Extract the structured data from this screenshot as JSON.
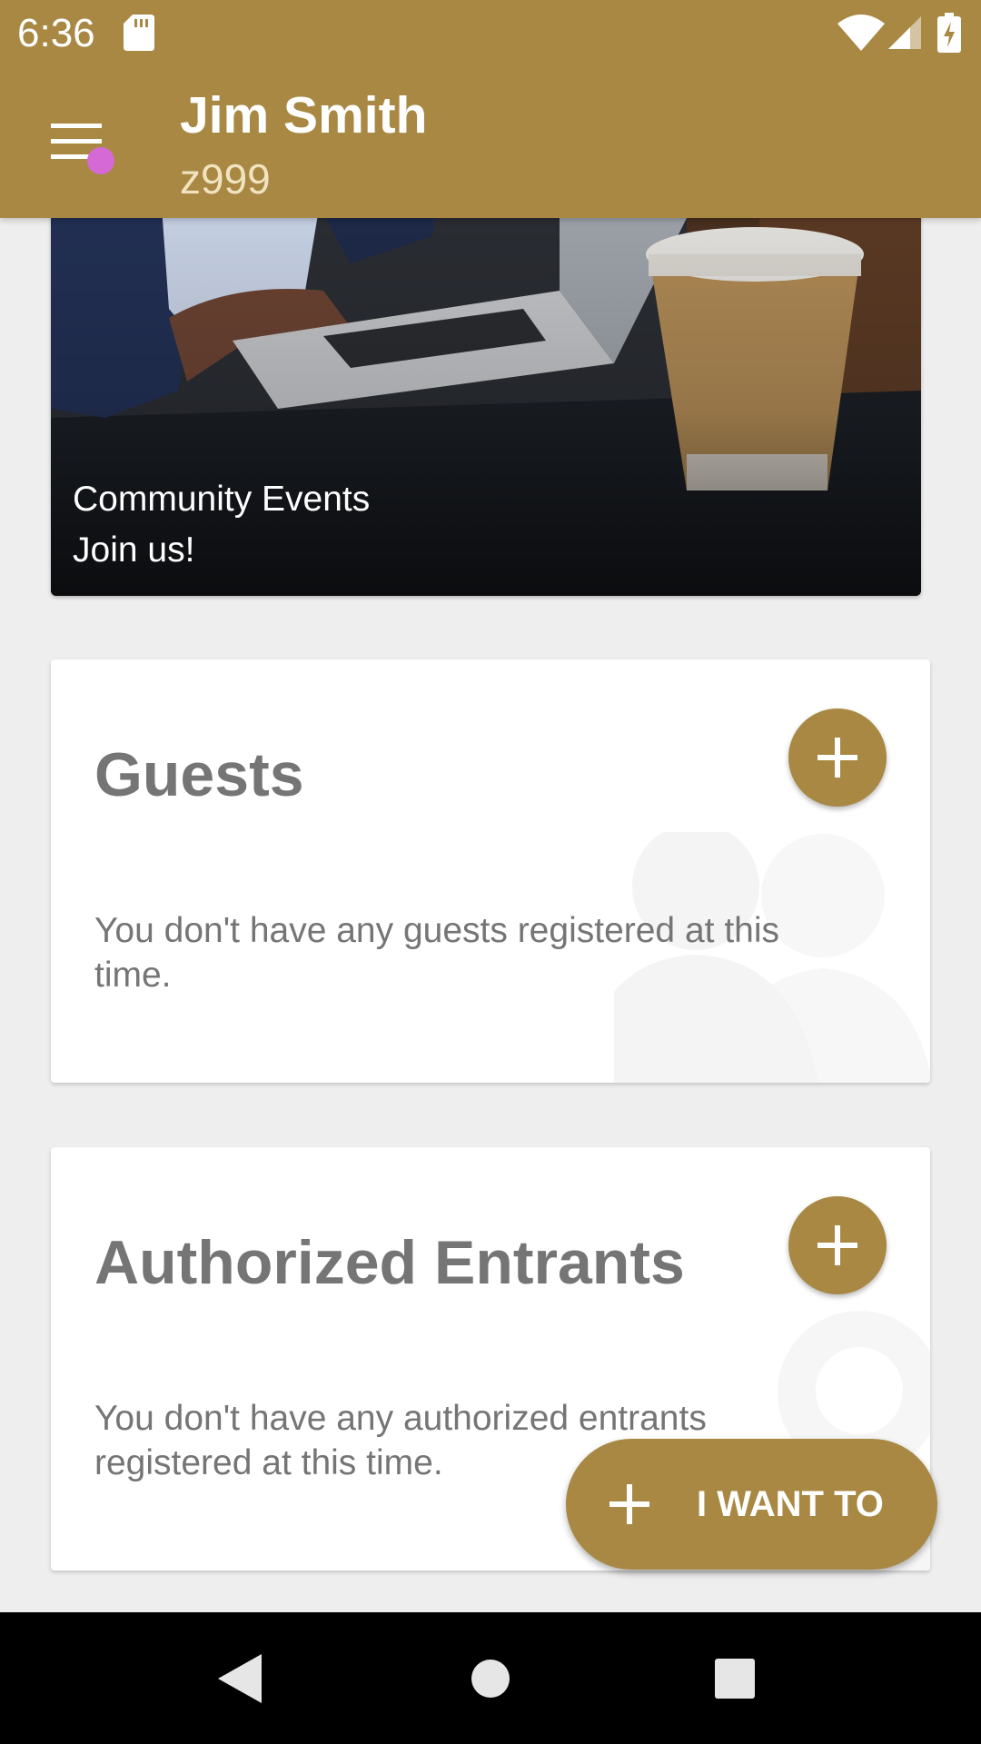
{
  "status_bar": {
    "time": "6:36",
    "icons": [
      "sd-card-icon",
      "wifi-icon",
      "signal-icon",
      "battery-charging-icon"
    ]
  },
  "app_bar": {
    "menu_icon": "hamburger-menu-icon",
    "notification_dot_color": "#d56ad6",
    "title": "Jim Smith",
    "subtitle": "z999"
  },
  "banner": {
    "image": "laptop-and-coffee-photo",
    "title": "Community Events",
    "subtitle": "Join us!"
  },
  "cards": [
    {
      "title": "Guests",
      "message": "You don't have any guests registered at this time.",
      "action_icon": "plus-icon"
    },
    {
      "title": "Authorized Entrants",
      "message": "You don't have any authorized entrants registered at this time.",
      "action_icon": "plus-icon"
    }
  ],
  "fab": {
    "icon": "plus-icon",
    "label": "I WANT TO"
  },
  "nav_bar": {
    "icons": [
      "back-icon",
      "home-icon",
      "recents-icon"
    ]
  },
  "colors": {
    "primary": "#a88843",
    "background": "#eeeeee",
    "card": "#ffffff",
    "text_gray": "#757575"
  }
}
